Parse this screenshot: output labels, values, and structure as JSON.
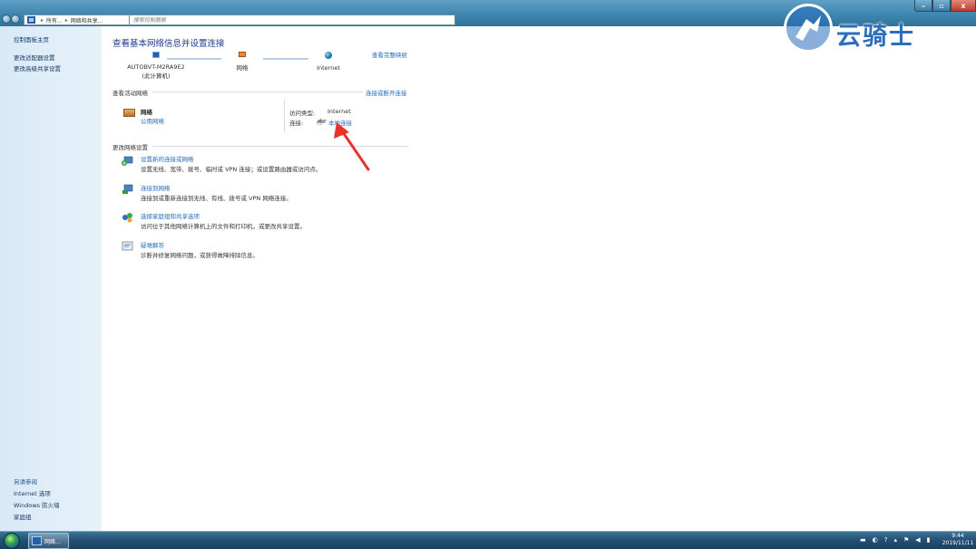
{
  "window": {
    "breadcrumb": [
      "所有...",
      "网络和共享..."
    ],
    "search_placeholder": "搜索控制面板",
    "controls": {
      "minimize": "–",
      "maximize": "▫",
      "close": "x"
    },
    "help": "?"
  },
  "watermark": {
    "text": "云骑士"
  },
  "sidebar": {
    "links": [
      "控制面板主页",
      "更改适配器设置",
      "更改高级共享设置"
    ],
    "see_also_title": "另请参阅",
    "see_also": [
      "Internet 选项",
      "Windows 防火墙",
      "家庭组"
    ]
  },
  "main": {
    "title": "查看基本网络信息并设置连接",
    "full_map_link": "查看完整映射",
    "map": {
      "computer": "AUTOBVT-M2RA9E2",
      "computer_sub": "(此计算机)",
      "network": "网络",
      "internet": "Internet"
    },
    "active_header": "查看活动网络",
    "disconnect_link": "连接或断开连接",
    "active": {
      "name": "网络",
      "type": "公用网络",
      "access_label": "访问类型:",
      "access_value": "Internet",
      "conn_label": "连接:",
      "conn_value": "本地连接"
    },
    "change_header": "更改网络设置",
    "tasks": [
      {
        "title": "设置新的连接或网络",
        "desc": "设置无线、宽带、拨号、临时或 VPN 连接；或设置路由器或访问点。"
      },
      {
        "title": "连接到网络",
        "desc": "连接到或重新连接到无线、有线、拨号或 VPN 网络连接。"
      },
      {
        "title": "选择家庭组和共享选项",
        "desc": "访问位于其他网络计算机上的文件和打印机，或更改共享设置。"
      },
      {
        "title": "疑难解答",
        "desc": "诊断并修复网络问题，或获得故障排除信息。"
      }
    ]
  },
  "taskbar": {
    "active_window_label": "网络...",
    "time": "9:44",
    "date": "2019/11/11"
  },
  "colors": {
    "link": "#1f6bc2",
    "title": "#1e3a8a",
    "annotation_arrow": "#e8332a"
  }
}
